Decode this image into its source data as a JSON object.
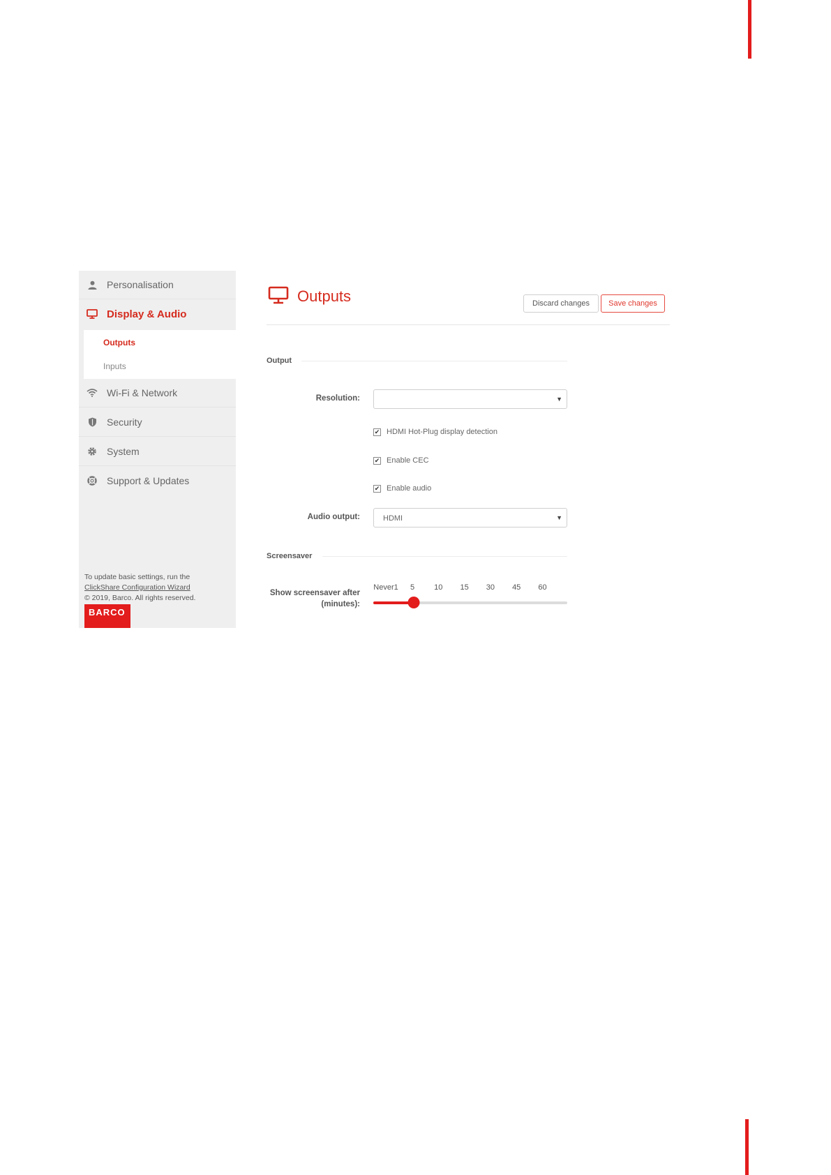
{
  "sidebar": {
    "items": [
      {
        "label": "Personalisation",
        "icon": "user-icon"
      },
      {
        "label": "Display & Audio",
        "icon": "monitor-icon"
      },
      {
        "label": "Wi-Fi & Network",
        "icon": "wifi-icon"
      },
      {
        "label": "Security",
        "icon": "shield-icon"
      },
      {
        "label": "System",
        "icon": "gear-icon"
      },
      {
        "label": "Support & Updates",
        "icon": "lifebuoy-icon"
      }
    ],
    "subitems": [
      {
        "label": "Outputs"
      },
      {
        "label": "Inputs"
      }
    ],
    "footer": {
      "line1": "To update basic settings, run the",
      "link": "ClickShare Configuration Wizard",
      "copyright": "© 2019, Barco. All rights reserved.",
      "logo": "BARCO"
    }
  },
  "header": {
    "title": "Outputs",
    "discard_label": "Discard changes",
    "save_label": "Save changes"
  },
  "output_section": {
    "title": "Output",
    "resolution_label": "Resolution:",
    "resolution_value": "",
    "checkboxes": [
      {
        "label": "HDMI Hot-Plug display detection",
        "checked": true
      },
      {
        "label": "Enable CEC",
        "checked": true
      },
      {
        "label": "Enable audio",
        "checked": true
      }
    ],
    "audio_output_label": "Audio output:",
    "audio_output_value": "HDMI"
  },
  "screensaver_section": {
    "title": "Screensaver",
    "label_line1": "Show screensaver after",
    "label_line2": "(minutes):",
    "ticks": [
      "Never1",
      "5",
      "10",
      "15",
      "30",
      "45",
      "60"
    ],
    "selected_index": 1
  },
  "colors": {
    "accent": "#e31c1c",
    "sidebar_bg": "#efefef"
  }
}
